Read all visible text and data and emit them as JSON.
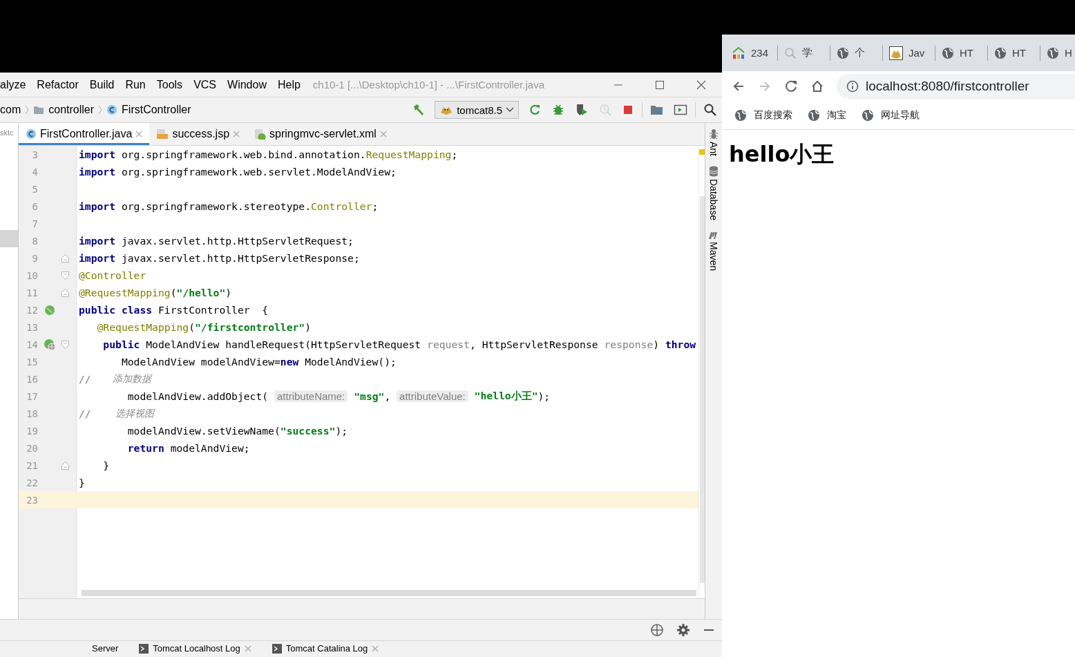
{
  "ide": {
    "menu": [
      "alyze",
      "Refactor",
      "Build",
      "Run",
      "Tools",
      "VCS",
      "Window",
      "Help"
    ],
    "title": "ch10-1 [...\\Desktop\\ch10-1] - ...\\FirstController.java",
    "project_panel": {
      "text": "sktc"
    },
    "breadcrumbs": [
      {
        "kind": "package",
        "label": "com"
      },
      {
        "kind": "folder",
        "label": "controller"
      },
      {
        "kind": "class",
        "label": "FirstController"
      }
    ],
    "run_config": "tomcat8.5",
    "toolbar": [
      {
        "kind": "build",
        "disabled": false
      },
      {
        "kind": "config",
        "disabled": false
      },
      {
        "kind": "rerun",
        "disabled": false
      },
      {
        "kind": "debug",
        "disabled": false
      },
      {
        "kind": "coverage",
        "disabled": false
      },
      {
        "kind": "profile",
        "disabled": true
      },
      {
        "kind": "stop",
        "disabled": false
      },
      {
        "kind": "structure",
        "disabled": false
      },
      {
        "kind": "console",
        "disabled": false
      },
      {
        "kind": "search",
        "disabled": false
      }
    ],
    "editor_tabs": [
      {
        "kind": "class",
        "label": "FirstController.java",
        "selected": true
      },
      {
        "kind": "jsp",
        "label": "success.jsp",
        "selected": false
      },
      {
        "kind": "xml",
        "label": "springmvc-servlet.xml",
        "selected": false
      }
    ],
    "lines": [
      {
        "number": "3",
        "current": false,
        "tokens": [
          {
            "kind": "kw",
            "text": "import"
          },
          {
            "kind": "plain",
            "text": " org.springframework.web.bind.annotation."
          },
          {
            "kind": "ann",
            "text": "RequestMapping"
          },
          {
            "kind": "plain",
            "text": ";"
          }
        ]
      },
      {
        "number": "4",
        "current": false,
        "tokens": [
          {
            "kind": "kw",
            "text": "import"
          },
          {
            "kind": "plain",
            "text": " org.springframework.web.servlet.ModelAndView;"
          }
        ]
      },
      {
        "number": "5",
        "current": false
      },
      {
        "number": "6",
        "current": false,
        "tokens": [
          {
            "kind": "kw",
            "text": "import"
          },
          {
            "kind": "plain",
            "text": " org.springframework.stereotype."
          },
          {
            "kind": "ann",
            "text": "Controller"
          },
          {
            "kind": "plain",
            "text": ";"
          }
        ]
      },
      {
        "number": "7",
        "current": false
      },
      {
        "number": "8",
        "current": false,
        "tokens": [
          {
            "kind": "kw",
            "text": "import"
          },
          {
            "kind": "plain",
            "text": " javax.servlet.http.HttpServletRequest;"
          }
        ]
      },
      {
        "number": "9",
        "current": false,
        "fold": {
          "kind": "end"
        },
        "tokens": [
          {
            "kind": "kw",
            "text": "import"
          },
          {
            "kind": "plain",
            "text": " javax.servlet.http.HttpServletResponse;"
          }
        ]
      },
      {
        "number": "10",
        "current": false,
        "fold": {
          "kind": "start"
        },
        "tokens": [
          {
            "kind": "ann",
            "text": "@Controller"
          }
        ]
      },
      {
        "number": "11",
        "current": false,
        "fold": {
          "kind": "end"
        },
        "tokens": [
          {
            "kind": "ann",
            "text": "@RequestMapping"
          },
          {
            "kind": "plain",
            "text": "("
          },
          {
            "kind": "str",
            "text": "\"/hello\""
          },
          {
            "kind": "plain",
            "text": ")"
          }
        ]
      },
      {
        "number": "12",
        "current": false,
        "gutter_icon": {
          "kind": "bean"
        },
        "tokens": [
          {
            "kind": "kw",
            "text": "public class"
          },
          {
            "kind": "plain",
            "text": " FirstController  {"
          }
        ]
      },
      {
        "number": "13",
        "current": false,
        "tokens": [
          {
            "kind": "ann",
            "text": "   @RequestMapping"
          },
          {
            "kind": "plain",
            "text": "("
          },
          {
            "kind": "str",
            "text": "\"/firstcontroller\""
          },
          {
            "kind": "plain",
            "text": ")"
          }
        ]
      },
      {
        "number": "14",
        "current": false,
        "gutter_icon": {
          "kind": "bean-web"
        },
        "fold": {
          "kind": "start"
        },
        "tokens": [
          {
            "kind": "kw",
            "text": "    public"
          },
          {
            "kind": "plain",
            "text": " ModelAndView handleRequest(HttpServletRequest "
          },
          {
            "kind": "param",
            "text": "request"
          },
          {
            "kind": "plain",
            "text": ", HttpServletResponse "
          },
          {
            "kind": "param",
            "text": "response"
          },
          {
            "kind": "plain",
            "text": ") "
          },
          {
            "kind": "kw",
            "text": "throw"
          }
        ]
      },
      {
        "number": "15",
        "current": false,
        "tokens": [
          {
            "kind": "plain",
            "text": "       ModelAndView modelAndView="
          },
          {
            "kind": "kw",
            "text": "new"
          },
          {
            "kind": "plain",
            "text": " ModelAndView();"
          }
        ]
      },
      {
        "number": "16",
        "current": false,
        "tokens": [
          {
            "kind": "comment",
            "text": "//"
          },
          {
            "kind": "note",
            "text": "       添加数据"
          }
        ]
      },
      {
        "number": "17",
        "current": false,
        "tokens": [
          {
            "kind": "plain",
            "text": "        modelAndView.addObject( "
          },
          {
            "kind": "hint",
            "text": "attributeName:"
          },
          {
            "kind": "str",
            "text": " \"msg\""
          },
          {
            "kind": "plain",
            "text": ", "
          },
          {
            "kind": "hint",
            "text": "attributeValue:"
          },
          {
            "kind": "str",
            "text": " \"hello小王\""
          },
          {
            "kind": "plain",
            "text": ");"
          }
        ]
      },
      {
        "number": "18",
        "current": false,
        "tokens": [
          {
            "kind": "comment",
            "text": "//"
          },
          {
            "kind": "note",
            "text": "        选择视图"
          }
        ]
      },
      {
        "number": "19",
        "current": false,
        "tokens": [
          {
            "kind": "plain",
            "text": "        modelAndView.setViewName("
          },
          {
            "kind": "str",
            "text": "\"success\""
          },
          {
            "kind": "plain",
            "text": ");"
          }
        ]
      },
      {
        "number": "20",
        "current": false,
        "tokens": [
          {
            "kind": "kw",
            "text": "        return"
          },
          {
            "kind": "plain",
            "text": " modelAndView;"
          }
        ]
      },
      {
        "number": "21",
        "current": false,
        "fold": {
          "kind": "end"
        },
        "tokens": [
          {
            "kind": "plain",
            "text": "    }"
          }
        ]
      },
      {
        "number": "22",
        "current": false,
        "tokens": [
          {
            "kind": "plain",
            "text": "}"
          }
        ]
      },
      {
        "number": "23",
        "current": true
      }
    ],
    "side_tools": [
      {
        "kind": "ant",
        "label": "Ant"
      },
      {
        "kind": "database",
        "label": "Database"
      },
      {
        "kind": "maven",
        "label": "Maven"
      }
    ],
    "bottom_tabs": [
      {
        "kind": "plain",
        "label": "Server"
      },
      {
        "kind": "log",
        "label": "Tomcat Localhost Log"
      },
      {
        "kind": "log",
        "label": "Tomcat Catalina Log"
      }
    ]
  },
  "browser": {
    "tabs": [
      {
        "kind": "site",
        "label": "234"
      },
      {
        "kind": "search",
        "label": "学"
      },
      {
        "kind": "globe",
        "label": "个"
      },
      {
        "kind": "tomcat",
        "label": "Jav"
      },
      {
        "kind": "globe",
        "label": "HT"
      },
      {
        "kind": "globe",
        "label": "HT"
      },
      {
        "kind": "globe",
        "label": "H"
      }
    ],
    "forward_disabled": true,
    "address": "localhost:8080/firstcontroller",
    "bookmarks": [
      "百度搜索",
      "淘宝",
      "网址导航"
    ],
    "page_heading": "hello小王"
  }
}
